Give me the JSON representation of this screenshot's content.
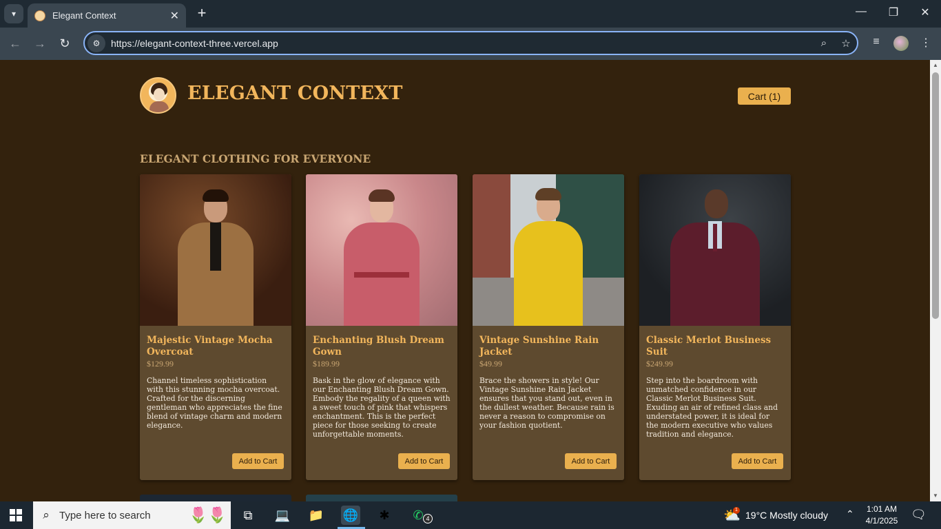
{
  "browser": {
    "tab_title": "Elegant Context",
    "url": "https://elegant-context-three.vercel.app",
    "icons": [
      "tab-search-icon",
      "close-icon",
      "new-tab-icon",
      "minimize-icon",
      "restore-icon",
      "close-window-icon",
      "back-icon",
      "forward-icon",
      "reload-icon",
      "site-info-icon",
      "zoom-icon",
      "bookmark-star-icon",
      "media-controls-icon",
      "profile-avatar",
      "menu-kebab-icon"
    ]
  },
  "site": {
    "brand": "ELEGANT CONTEXT",
    "cart_label": "Cart (1)",
    "section_title": "ELEGANT CLOTHING FOR EVERYONE",
    "add_to_cart_label": "Add to Cart",
    "products": [
      {
        "title": "Majestic Vintage Mocha Overcoat",
        "price": "$129.99",
        "description": "Channel timeless sophistication with this stunning mocha overcoat. Crafted for the discerning gentleman who appreciates the fine blend of vintage charm and modern elegance."
      },
      {
        "title": "Enchanting Blush Dream Gown",
        "price": "$189.99",
        "description": "Bask in the glow of elegance with our Enchanting Blush Dream Gown. Embody the regality of a queen with a sweet touch of pink that whispers enchantment. This is the perfect piece for those seeking to create unforgettable moments."
      },
      {
        "title": "Vintage Sunshine Rain Jacket",
        "price": "$49.99",
        "description": "Brace the showers in style! Our Vintage Sunshine Rain Jacket ensures that you stand out, even in the dullest weather. Because rain is never a reason to compromise on your fashion quotient."
      },
      {
        "title": "Classic Merlot Business Suit",
        "price": "$249.99",
        "description": "Step into the boardroom with unmatched confidence in our Classic Merlot Business Suit. Exuding an air of refined class and understated power, it is ideal for the modern executive who values tradition and elegance."
      }
    ],
    "colors": {
      "background": "#33220d",
      "card": "#5e4a2f",
      "accent": "#eab04e",
      "title": "#f2b65c"
    }
  },
  "taskbar": {
    "search_placeholder": "Type here to search",
    "whatsapp_badge": "4",
    "weather_badge": "1",
    "weather": "19°C  Mostly cloudy",
    "time": "1:01 AM",
    "date": "4/1/2025"
  }
}
